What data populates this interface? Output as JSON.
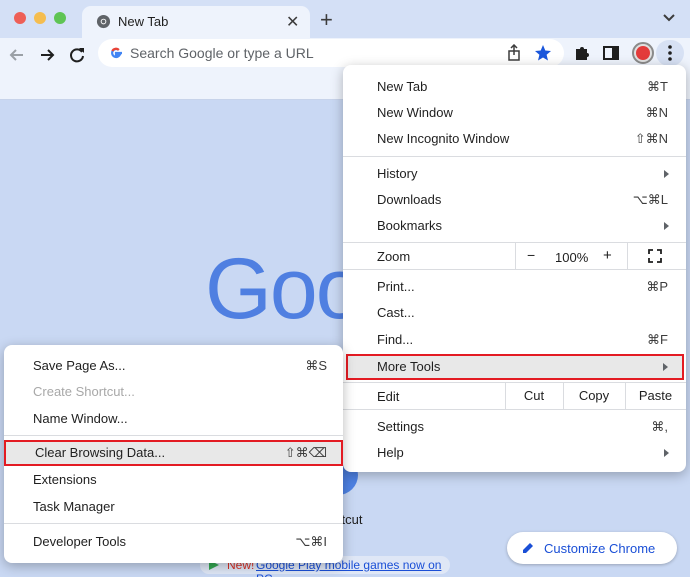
{
  "tab": {
    "title": "New Tab"
  },
  "omnibox": {
    "placeholder": "Search Google or type a URL"
  },
  "page": {
    "logo_text": "Goo",
    "shortcut_label": "ortcut",
    "banner_new": "New!",
    "banner_link": "Google Play mobile games now on PC",
    "customize_label": "Customize Chrome"
  },
  "menu": {
    "new_tab": {
      "label": "New Tab",
      "shortcut": "⌘T"
    },
    "new_window": {
      "label": "New Window",
      "shortcut": "⌘N"
    },
    "new_incognito": {
      "label": "New Incognito Window",
      "shortcut": "⇧⌘N"
    },
    "history": {
      "label": "History"
    },
    "downloads": {
      "label": "Downloads",
      "shortcut": "⌥⌘L"
    },
    "bookmarks": {
      "label": "Bookmarks"
    },
    "zoom": {
      "label": "Zoom",
      "minus": "−",
      "value": "100%",
      "plus": "+"
    },
    "print": {
      "label": "Print...",
      "shortcut": "⌘P"
    },
    "cast": {
      "label": "Cast..."
    },
    "find": {
      "label": "Find...",
      "shortcut": "⌘F"
    },
    "more_tools": {
      "label": "More Tools"
    },
    "edit": {
      "label": "Edit",
      "cut": "Cut",
      "copy": "Copy",
      "paste": "Paste"
    },
    "settings": {
      "label": "Settings",
      "shortcut": "⌘,"
    },
    "help": {
      "label": "Help"
    }
  },
  "submenu": {
    "save_page": {
      "label": "Save Page As...",
      "shortcut": "⌘S"
    },
    "create_shortcut": {
      "label": "Create Shortcut..."
    },
    "name_window": {
      "label": "Name Window..."
    },
    "clear_browsing": {
      "label": "Clear Browsing Data...",
      "shortcut": "⇧⌘⌫"
    },
    "extensions": {
      "label": "Extensions"
    },
    "task_manager": {
      "label": "Task Manager"
    },
    "developer_tools": {
      "label": "Developer Tools",
      "shortcut": "⌥⌘I"
    }
  },
  "colors": {
    "highlight_border": "#e31b23",
    "accent_blue": "#1a4fd6",
    "logo_blue": "#4f7fe1"
  },
  "icons": [
    "chrome-icon",
    "close-icon",
    "plus-icon",
    "chevron-down-icon",
    "back-arrow-icon",
    "forward-arrow-icon",
    "reload-icon",
    "google-g-icon",
    "share-icon",
    "star-icon",
    "puzzle-icon",
    "side-panel-icon",
    "kebab-menu-icon",
    "fullscreen-icon",
    "pencil-icon",
    "play-store-icon"
  ]
}
